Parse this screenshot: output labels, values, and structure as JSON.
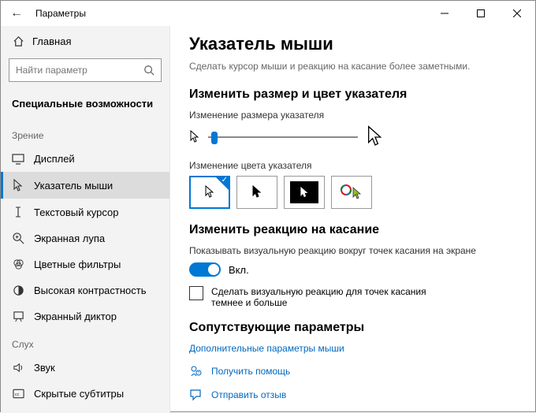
{
  "window": {
    "title": "Параметры"
  },
  "sidebar": {
    "home": "Главная",
    "search_placeholder": "Найти параметр",
    "section": "Специальные возможности",
    "group_vision": "Зрение",
    "group_hearing": "Слух",
    "items": [
      {
        "label": "Дисплей"
      },
      {
        "label": "Указатель мыши"
      },
      {
        "label": "Текстовый курсор"
      },
      {
        "label": "Экранная лупа"
      },
      {
        "label": "Цветные фильтры"
      },
      {
        "label": "Высокая контрастность"
      },
      {
        "label": "Экранный диктор"
      }
    ],
    "hearing_items": [
      {
        "label": "Звук"
      },
      {
        "label": "Скрытые субтитры"
      }
    ]
  },
  "main": {
    "title": "Указатель мыши",
    "subtitle": "Сделать курсор мыши и реакцию на касание более заметными.",
    "section1": "Изменить размер и цвет указателя",
    "size_label": "Изменение размера указателя",
    "color_label": "Изменение цвета указателя",
    "section2": "Изменить реакцию на касание",
    "touch_desc": "Показывать визуальную реакцию вокруг точек касания на экране",
    "toggle_state": "Вкл.",
    "touch_darker": "Сделать визуальную реакцию для точек касания темнее и больше",
    "section3": "Сопутствующие параметры",
    "link_more": "Дополнительные параметры мыши",
    "help": "Получить помощь",
    "feedback": "Отправить отзыв"
  }
}
